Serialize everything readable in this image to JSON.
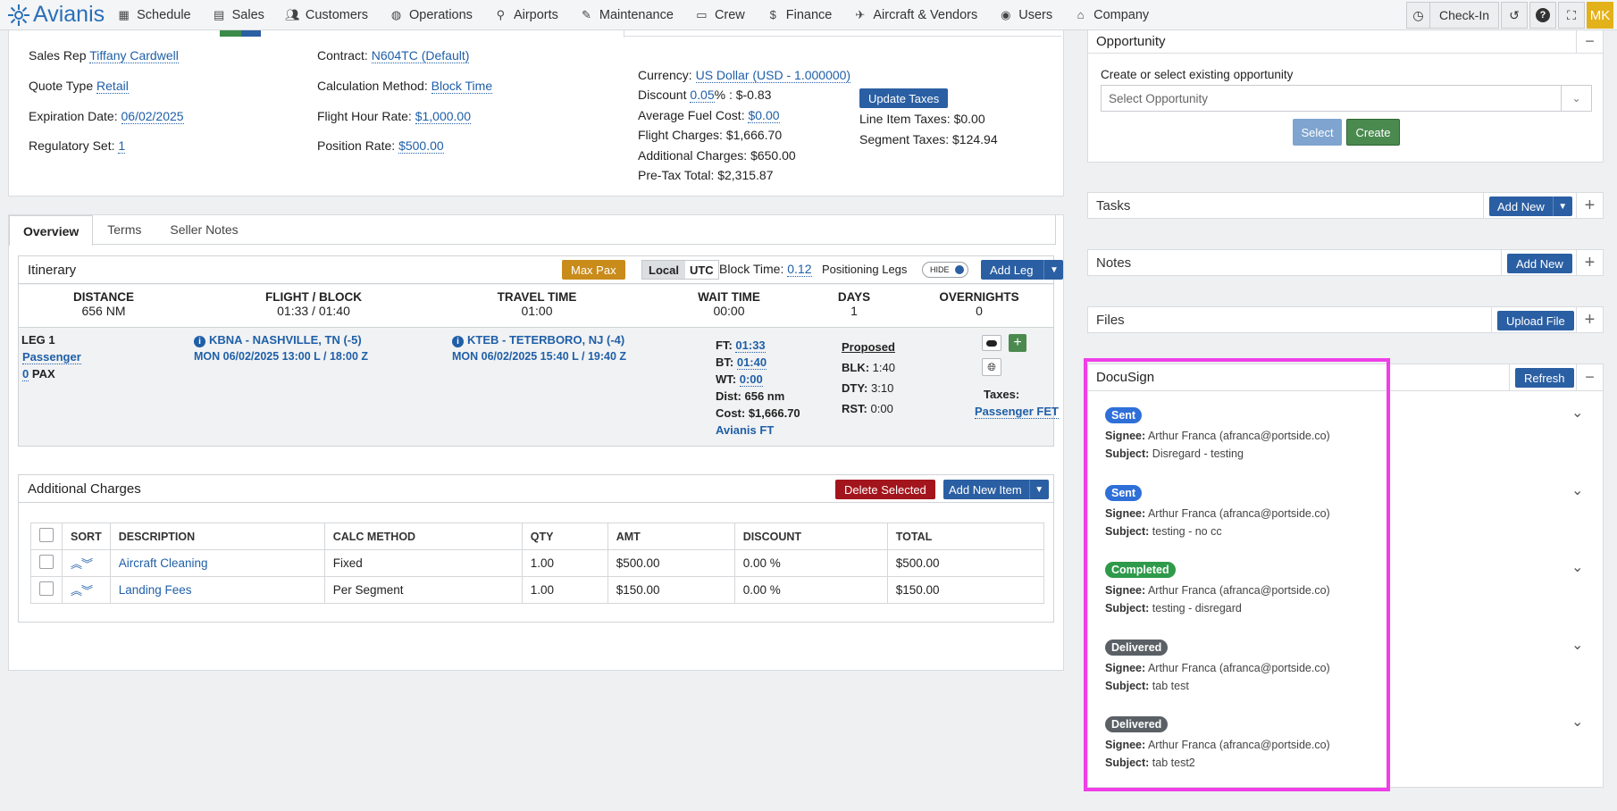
{
  "nav": {
    "brand": "Avianis",
    "items": [
      {
        "label": "Schedule",
        "icon": "calendar-icon"
      },
      {
        "label": "Sales",
        "icon": "document-icon"
      },
      {
        "label": "Customers",
        "icon": "users-icon"
      },
      {
        "label": "Operations",
        "icon": "globe-icon"
      },
      {
        "label": "Airports",
        "icon": "map-pin-icon"
      },
      {
        "label": "Maintenance",
        "icon": "wrench-icon"
      },
      {
        "label": "Crew",
        "icon": "id-card-icon"
      },
      {
        "label": "Finance",
        "icon": "dollar-icon"
      },
      {
        "label": "Aircraft & Vendors",
        "icon": "plane-icon"
      },
      {
        "label": "Users",
        "icon": "user-circle-icon"
      },
      {
        "label": "Company",
        "icon": "building-icon"
      }
    ],
    "checkin_label": "Check-In",
    "avatar_initials": "MK"
  },
  "quote": {
    "sales_rep_label": "Sales Rep",
    "sales_rep": "Tiffany Cardwell",
    "quote_type_label": "Quote Type",
    "quote_type": "Retail",
    "expiration_label": "Expiration Date:",
    "expiration": "06/02/2025",
    "regulatory_label": "Regulatory Set:",
    "regulatory": "1",
    "contract_label": "Contract:",
    "contract": "N604TC (Default)",
    "calc_method_label": "Calculation Method:",
    "calc_method": "Block Time",
    "flight_rate_label": "Flight Hour Rate:",
    "flight_rate": "$1,000.00",
    "position_rate_label": "Position Rate:",
    "position_rate": "$500.00",
    "currency_label": "Currency:",
    "currency": "US Dollar (USD - 1.000000)",
    "discount_label": "Discount",
    "discount_pct": "0.05",
    "discount_rest": "% : $-0.83",
    "avg_fuel_label": "Average Fuel Cost:",
    "avg_fuel": "$0.00",
    "flight_charges": "Flight Charges: $1,666.70",
    "additional_charges": "Additional Charges: $650.00",
    "pretax_total": "Pre-Tax Total: $2,315.87",
    "update_taxes_label": "Update Taxes",
    "line_item_taxes": "Line Item Taxes: $0.00",
    "segment_taxes": "Segment Taxes: $124.94"
  },
  "tabs": [
    "Overview",
    "Terms",
    "Seller Notes"
  ],
  "itinerary": {
    "title": "Itinerary",
    "max_pax_label": "Max Pax",
    "local_label": "Local",
    "utc_label": "UTC",
    "block_time_label": "Block Time:",
    "block_time": "0.12",
    "positioning_label": "Positioning Legs",
    "hide_label": "HIDE",
    "add_leg_label": "Add Leg",
    "stats": [
      {
        "label": "DISTANCE",
        "value": "656 NM"
      },
      {
        "label": "FLIGHT / BLOCK",
        "value": "01:33 / 01:40"
      },
      {
        "label": "TRAVEL TIME",
        "value": "01:00"
      },
      {
        "label": "WAIT TIME",
        "value": "00:00"
      },
      {
        "label": "DAYS",
        "value": "1"
      },
      {
        "label": "OVERNIGHTS",
        "value": "0"
      }
    ],
    "leg": {
      "title": "LEG 1",
      "type": "Passenger",
      "pax_count": "0",
      "pax_label": "PAX",
      "from": "KBNA - NASHVILLE, TN (-5)",
      "from_time": "MON 06/02/2025 13:00 L / 18:00 Z",
      "to": "KTEB - TETERBORO, NJ (-4)",
      "to_time": "MON 06/02/2025 15:40 L / 19:40 Z",
      "ft_label": "FT:",
      "ft": "01:33",
      "bt_label": "BT:",
      "bt": "01:40",
      "wt_label": "WT:",
      "wt": "0:00",
      "dist": "Dist: 656 nm",
      "cost": "Cost: $1,666.70",
      "operator": "Avianis FT",
      "proposed_label": "Proposed",
      "blk_label": "BLK:",
      "blk": "1:40",
      "dty_label": "DTY:",
      "dty": "3:10",
      "rst_label": "RST:",
      "rst": "0:00",
      "taxes_label": "Taxes:",
      "taxes": "Passenger FET"
    }
  },
  "additional": {
    "title": "Additional Charges",
    "delete_label": "Delete Selected",
    "add_label": "Add New Item",
    "headers": [
      "SORT",
      "DESCRIPTION",
      "CALC METHOD",
      "QTY",
      "AMT",
      "DISCOUNT",
      "TOTAL"
    ],
    "rows": [
      {
        "description": "Aircraft Cleaning",
        "method": "Fixed",
        "qty": "1.00",
        "amt": "$500.00",
        "discount": "0.00 %",
        "total": "$500.00"
      },
      {
        "description": "Landing Fees",
        "method": "Per Segment",
        "qty": "1.00",
        "amt": "$150.00",
        "discount": "0.00 %",
        "total": "$150.00"
      }
    ]
  },
  "opportunity": {
    "title": "Opportunity",
    "label": "Create or select existing opportunity",
    "placeholder": "Select Opportunity",
    "select_label": "Select",
    "create_label": "Create"
  },
  "tasks": {
    "title": "Tasks",
    "add_label": "Add New"
  },
  "notes": {
    "title": "Notes",
    "add_label": "Add New"
  },
  "files": {
    "title": "Files",
    "upload_label": "Upload File"
  },
  "docusign": {
    "title": "DocuSign",
    "refresh_label": "Refresh",
    "signee_label": "Signee:",
    "subject_label": "Subject:",
    "items": [
      {
        "status": "Sent",
        "color": "#2f6fd8",
        "signee": "Arthur Franca (afranca@portside.co)",
        "subject": "Disregard - testing"
      },
      {
        "status": "Sent",
        "color": "#2f6fd8",
        "signee": "Arthur Franca (afranca@portside.co)",
        "subject": "testing - no cc"
      },
      {
        "status": "Completed",
        "color": "#2e9a4a",
        "signee": "Arthur Franca (afranca@portside.co)",
        "subject": "testing - disregard"
      },
      {
        "status": "Delivered",
        "color": "#5a6066",
        "signee": "Arthur Franca (afranca@portside.co)",
        "subject": "tab test"
      },
      {
        "status": "Delivered",
        "color": "#5a6066",
        "signee": "Arthur Franca (afranca@portside.co)",
        "subject": "tab test2"
      }
    ]
  }
}
